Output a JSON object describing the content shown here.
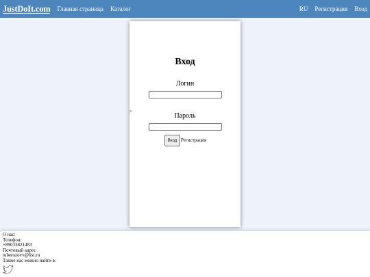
{
  "navbar": {
    "logo": "JustDoIt.com",
    "home": "Главная страница",
    "catalog": "Каталог",
    "lang": "RU",
    "register": "Регистрация",
    "login": "Вход"
  },
  "form": {
    "title": "Вход",
    "login_label": "Логин",
    "password_label": "Пароль",
    "arrow": ">",
    "submit": "Вход",
    "register_link": "Регистрация"
  },
  "footer": {
    "about": "О нас:",
    "phone_label": "Телефон:",
    "phone": "+89033821483",
    "address_label": "Почтовый адрес",
    "email": "tuberozovv@list.ru",
    "social_label": "Также нас можно найти в:",
    "social_icon": "twitter-icon"
  },
  "colors": {
    "navbar": "#4d86bd",
    "background": "#eef3fb"
  }
}
